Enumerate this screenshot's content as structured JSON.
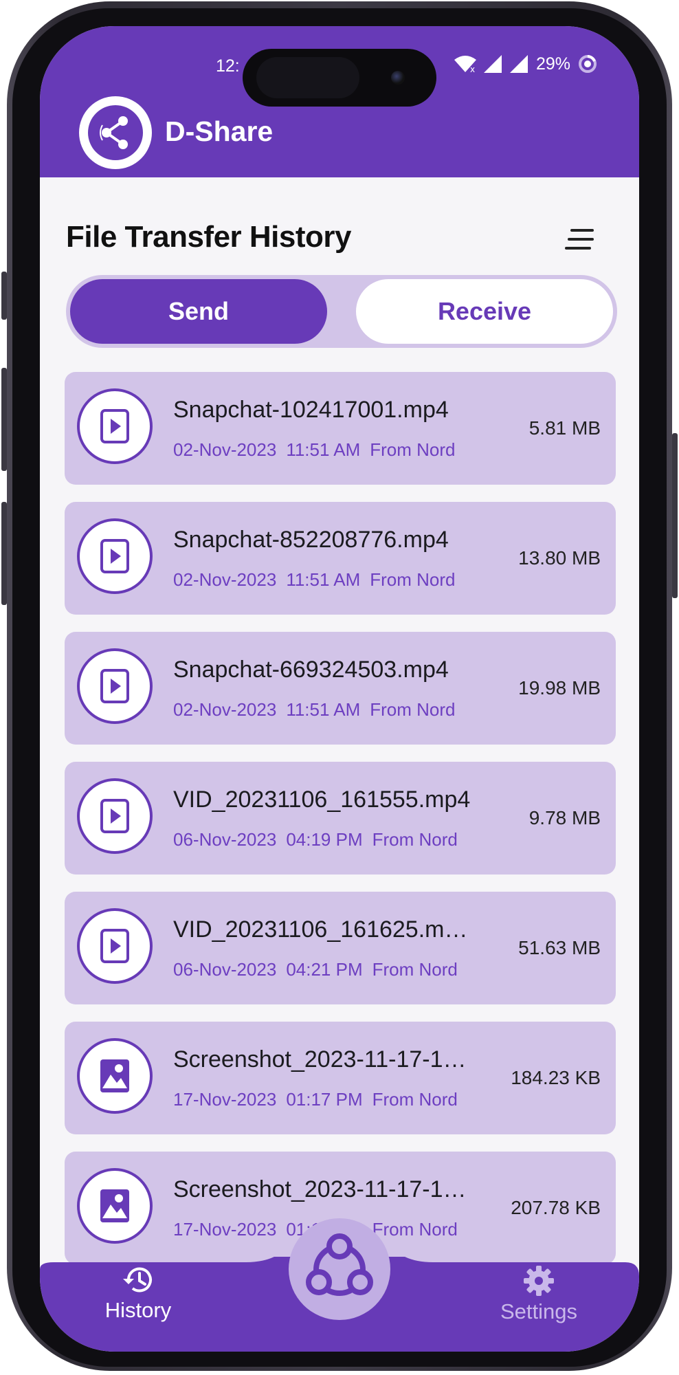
{
  "status_bar": {
    "time": "12:",
    "battery": "29%"
  },
  "app_bar": {
    "title": "D-Share",
    "logo_icon": "share-logo-icon"
  },
  "header": {
    "title": "File Transfer History",
    "sort_icon": "sort-icon"
  },
  "tabs": {
    "send_label": "Send",
    "receive_label": "Receive",
    "selected": "Send"
  },
  "files": [
    {
      "icon": "video-file-icon",
      "name": "Snapchat-102417001.mp4",
      "date": "02-Nov-2023",
      "time": "11:51 AM",
      "source": "From Nord",
      "size": "5.81 MB"
    },
    {
      "icon": "video-file-icon",
      "name": "Snapchat-852208776.mp4",
      "date": "02-Nov-2023",
      "time": "11:51 AM",
      "source": "From Nord",
      "size": "13.80 MB"
    },
    {
      "icon": "video-file-icon",
      "name": "Snapchat-669324503.mp4",
      "date": "02-Nov-2023",
      "time": "11:51 AM",
      "source": "From Nord",
      "size": "19.98 MB"
    },
    {
      "icon": "video-file-icon",
      "name": "VID_20231106_161555.mp4",
      "date": "06-Nov-2023",
      "time": "04:19 PM",
      "source": "From Nord",
      "size": "9.78 MB"
    },
    {
      "icon": "video-file-icon",
      "name": "VID_20231106_161625.m…",
      "date": "06-Nov-2023",
      "time": "04:21 PM",
      "source": "From Nord",
      "size": "51.63 MB"
    },
    {
      "icon": "image-file-icon",
      "name": "Screenshot_2023-11-17-1…",
      "date": "17-Nov-2023",
      "time": "01:17 PM",
      "source": "From Nord",
      "size": "184.23 KB"
    },
    {
      "icon": "image-file-icon",
      "name": "Screenshot_2023-11-17-1…",
      "date": "17-Nov-2023",
      "time": "01:17 PM",
      "source": "From Nord",
      "size": "207.78 KB"
    }
  ],
  "bottom_nav": {
    "history_label": "History",
    "settings_label": "Settings",
    "active": "History",
    "center_icon": "share-network-icon"
  },
  "colors": {
    "primary": "#673ab7",
    "card": "#d2c4e8",
    "meta_text": "#6d3fc1",
    "inactive_nav": "#c9b8ea"
  }
}
